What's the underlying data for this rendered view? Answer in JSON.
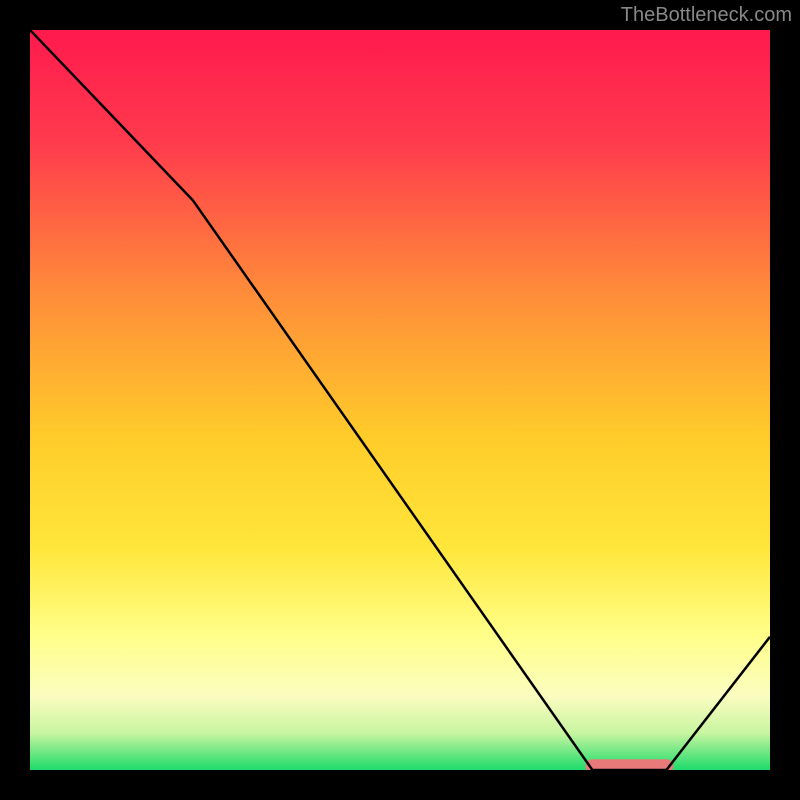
{
  "watermark": "TheBottleneck.com",
  "chart_data": {
    "type": "line",
    "title": "",
    "xlabel": "",
    "ylabel": "",
    "xlim": [
      0,
      100
    ],
    "ylim": [
      0,
      100
    ],
    "curve": {
      "x": [
        0,
        22,
        76,
        86,
        100
      ],
      "y": [
        100,
        77,
        0,
        0,
        18
      ]
    },
    "highlight_segment": {
      "x_start": 76,
      "x_end": 86,
      "y": 0.5,
      "color": "#e87a7a"
    },
    "background_gradient": {
      "type": "vertical",
      "stops": [
        {
          "offset": 0.0,
          "color": "#ff1a4d"
        },
        {
          "offset": 0.15,
          "color": "#ff3a4d"
        },
        {
          "offset": 0.35,
          "color": "#ff8a3a"
        },
        {
          "offset": 0.55,
          "color": "#ffcc2a"
        },
        {
          "offset": 0.7,
          "color": "#ffe63a"
        },
        {
          "offset": 0.82,
          "color": "#ffff8a"
        },
        {
          "offset": 0.9,
          "color": "#fbfdc0"
        },
        {
          "offset": 0.95,
          "color": "#c8f5a0"
        },
        {
          "offset": 1.0,
          "color": "#1edb6a"
        }
      ]
    }
  }
}
